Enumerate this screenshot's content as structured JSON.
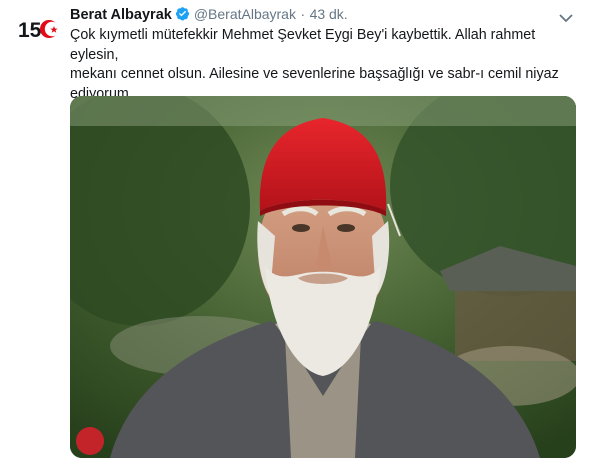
{
  "tweet": {
    "display_name": "Berat Albayrak",
    "handle": "@BeratAlbayrak",
    "separator": "·",
    "time": "43 dk.",
    "text_line1": "Çok kıymetli mütefekkir Mehmet Şevket Eygi Bey'i kaybettik. Allah rahmet eylesin,",
    "text_line2": "mekanı cennet olsun. Ailesine ve sevenlerine başsağlığı ve sabr-ı cemil niyaz",
    "text_line3": "ediyorum.",
    "avatar_text": "15",
    "icons": [
      "verified-badge-icon",
      "chevron-down-icon",
      "crescent-star-icon"
    ]
  },
  "colors": {
    "verified": "#1da1f2",
    "secondary_text": "#657786",
    "avatar_red": "#e30a17"
  }
}
